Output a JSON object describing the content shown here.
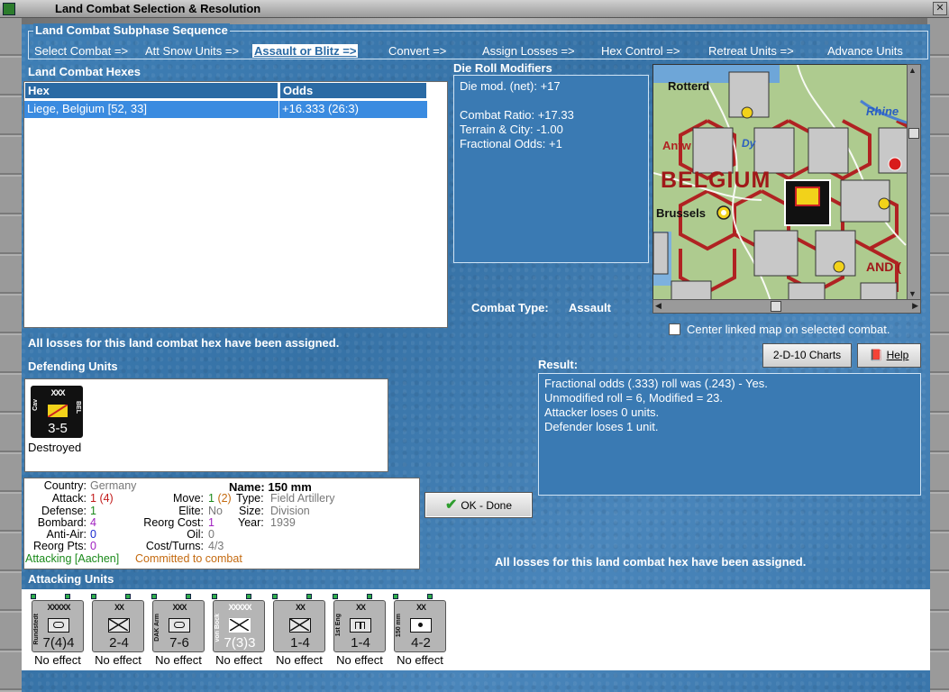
{
  "window": {
    "title": "Land Combat Selection & Resolution",
    "close_glyph": "✕"
  },
  "sequence": {
    "title": "Land Combat Subphase Sequence",
    "items": [
      "Select Combat =>",
      "Att Snow Units =>",
      "Assault or Blitz =>",
      "Convert =>",
      "Assign Losses =>",
      "Hex Control =>",
      "Retreat Units =>",
      "Advance Units"
    ]
  },
  "hexes": {
    "title": "Land Combat Hexes",
    "headers": [
      "Hex",
      "Odds"
    ],
    "rows": [
      {
        "hex": "Liege, Belgium [52, 33]",
        "odds": "+16.333 (26:3)"
      }
    ]
  },
  "modifiers": {
    "title": "Die Roll Modifiers",
    "lines": [
      "Die mod. (net): +17",
      "",
      "Combat Ratio: +17.33",
      "Terrain & City: -1.00",
      "Fractional Odds: +1"
    ]
  },
  "combat_type": {
    "label": "Combat Type:",
    "value": "Assault"
  },
  "map": {
    "labels": [
      "Rotterd",
      "Antw",
      "BELGIUM",
      "Brussels",
      "Rhine",
      "AND (",
      "Dy"
    ],
    "center_checkbox_label": "Center linked map on selected combat.",
    "center_checked": false
  },
  "buttons": {
    "charts": "2-D-10 Charts",
    "help": "Help",
    "ok": "OK - Done"
  },
  "losses_msg": "All losses for this land combat hex have been assigned.",
  "defending": {
    "title": "Defending Units",
    "units": [
      {
        "size": "XXX",
        "side_left": "Cav",
        "side_right": "BEL",
        "strength": "3-5",
        "status": "Destroyed"
      }
    ]
  },
  "result": {
    "title": "Result:",
    "lines": [
      "Fractional odds (.333) roll was (.243)  - Yes.",
      "Unmodified roll = 6, Modified = 23.",
      "Attacker loses 0 units.",
      "Defender loses 1 unit."
    ]
  },
  "details": {
    "country_label": "Country:",
    "country": "Germany",
    "attack_label": "Attack:",
    "attack": "1",
    "attack_paren": "(4)",
    "defense_label": "Defense:",
    "defense": "1",
    "bombard_label": "Bombard:",
    "bombard": "4",
    "antiair_label": "Anti-Air:",
    "antiair": "0",
    "reorgpts_label": "Reorg Pts:",
    "reorgpts": "0",
    "name_label": "Name:",
    "name": "150 mm",
    "move_label": "Move:",
    "move": "1",
    "move_paren": "(2)",
    "type_label": "Type:",
    "type": "Field Artillery",
    "elite_label": "Elite:",
    "elite": "No",
    "size_label": "Size:",
    "size": "Division",
    "reorgcost_label": "Reorg Cost:",
    "reorgcost": "1",
    "year_label": "Year:",
    "year": "1939",
    "oil_label": "Oil:",
    "oil": "0",
    "costturns_label": "Cost/Turns:",
    "costturns": "4/3",
    "attacking_status": "Attacking [Aachen]",
    "committed_status": "Committed to combat"
  },
  "attacking": {
    "title": "Attacking Units",
    "units": [
      {
        "size": "XXXXX",
        "side": "Rundstedt",
        "strength": "7(4)4",
        "effect": "No effect"
      },
      {
        "size": "XX",
        "side": "",
        "strength": "2-4",
        "effect": "No effect"
      },
      {
        "size": "XXX",
        "side": "DAK Arm",
        "strength": "7-6",
        "effect": "No effect"
      },
      {
        "size": "XXXXX",
        "side": "von Bock",
        "strength": "7(3)3",
        "effect": "No effect"
      },
      {
        "size": "XX",
        "side": "",
        "strength": "1-4",
        "effect": "No effect"
      },
      {
        "size": "XX",
        "side": "1st Eng",
        "strength": "1-4",
        "effect": "No effect"
      },
      {
        "size": "XX",
        "side": "150 mm",
        "strength": "4-2",
        "effect": "No effect"
      }
    ]
  },
  "colors": {
    "panel": "#3c7ab0",
    "selected_row": "#3a8be0",
    "led": "#2fae4b"
  }
}
